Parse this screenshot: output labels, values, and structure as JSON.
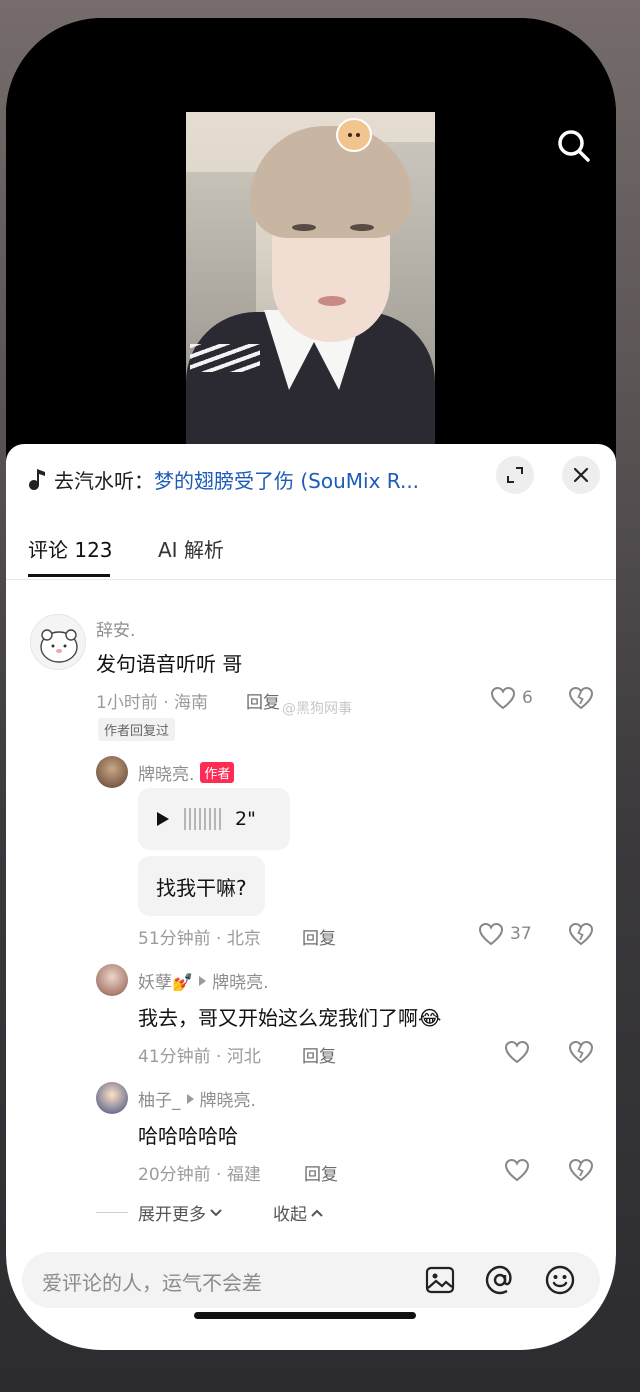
{
  "music": {
    "prefix": "去汽水听：",
    "title": "梦的翅膀受了伤 (SouMix R..."
  },
  "tabs": [
    {
      "label": "评论 123",
      "active": true
    },
    {
      "label": "AI 解析",
      "active": false
    }
  ],
  "watermark": "@黑狗网事",
  "comments": [
    {
      "username": "辞安.",
      "text": "发句语音听听 哥",
      "meta": "1小时前 · 海南",
      "reply_label": "回复",
      "likes": "6",
      "author_replied": "作者回复过"
    }
  ],
  "replies": [
    {
      "username": "牌晓亮.",
      "author_tag": "作者",
      "voice_duration": "2\"",
      "text": "找我干嘛?",
      "meta": "51分钟前 · 北京",
      "reply_label": "回复",
      "likes": "37"
    },
    {
      "username": "妖孽💅",
      "reply_to": "牌晓亮.",
      "text": "我去，哥又开始这么宠我们了啊😂",
      "meta": "41分钟前 · 河北",
      "reply_label": "回复"
    },
    {
      "username": "柚子_",
      "reply_to": "牌晓亮.",
      "text": "哈哈哈哈哈",
      "meta": "20分钟前 · 福建",
      "reply_label": "回复"
    }
  ],
  "expand_more": "展开更多",
  "collapse": "收起",
  "input": {
    "placeholder": "爱评论的人，运气不会差"
  },
  "colors": {
    "link": "#1e5bb8",
    "author_tag": "#fe2c55"
  }
}
